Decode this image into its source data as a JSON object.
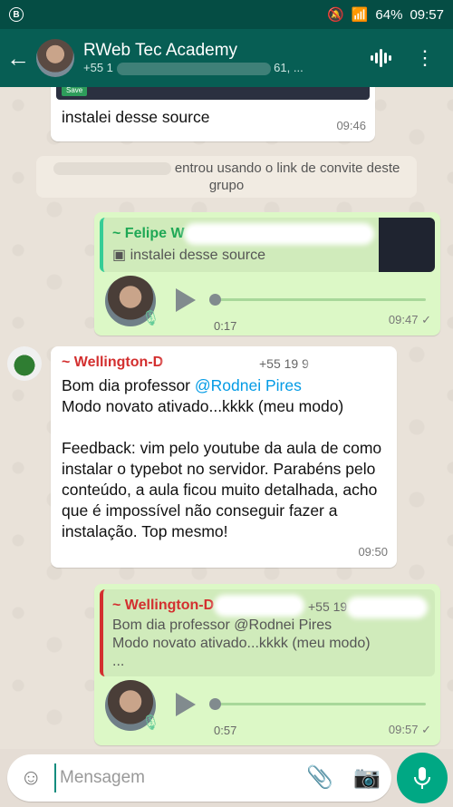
{
  "status": {
    "carrier_icon": "b-icon",
    "battery": "64%",
    "time": "09:57"
  },
  "header": {
    "title": "RWeb Tec Academy",
    "subtitle_start": "+55 1",
    "subtitle_end": "61, ..."
  },
  "messages": {
    "m1": {
      "text": "instalei desse source",
      "time": "09:46",
      "save_label": "Save"
    },
    "sys": {
      "text": "entrou usando o link de convite deste grupo"
    },
    "m2": {
      "sender": "~ Felipe W",
      "quoted": "instalei desse source",
      "duration": "0:17",
      "time": "09:47"
    },
    "m3": {
      "sender": "~ Wellington-D",
      "phone": "+55 19 9",
      "line1_a": "Bom dia professor ",
      "mention": "@Rodnei Pires",
      "line2": "Modo novato ativado...kkkk (meu modo)",
      "body": "Feedback: vim pelo youtube da aula de como instalar o typebot no servidor. Parabéns pelo conteúdo, a aula ficou muito detalhada, acho que é impossível não conseguir fazer a instalação. Top mesmo!",
      "time": "09:50"
    },
    "m4": {
      "sender": "~ Wellington-D",
      "phone": "+55 19",
      "q1": "Bom dia professor @Rodnei Pires",
      "q2": "Modo novato ativado...kkkk (meu modo)",
      "q3": "...",
      "duration": "0:57",
      "time": "09:57"
    }
  },
  "composer": {
    "placeholder": "Mensagem"
  },
  "colors": {
    "header": "#075e54",
    "outgoing": "#dcf8c6",
    "accent": "#00a884"
  }
}
